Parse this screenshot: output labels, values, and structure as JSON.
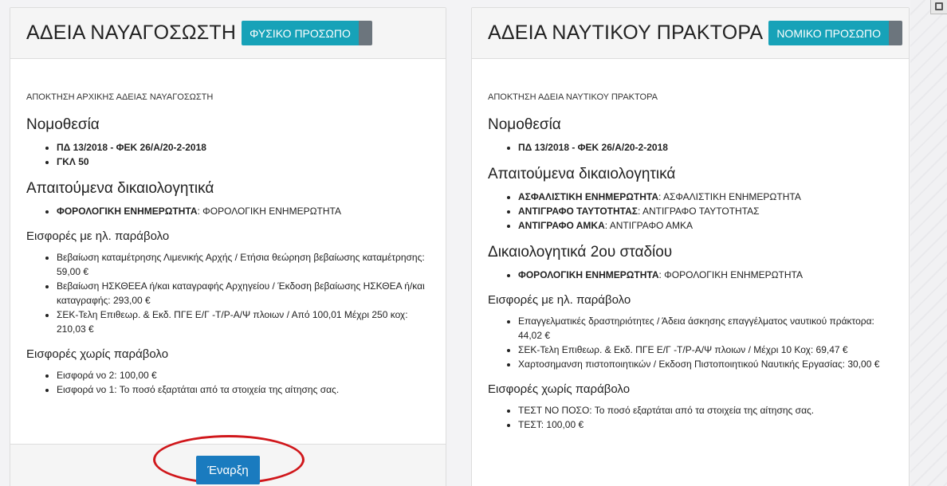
{
  "left_card": {
    "title": "ΑΔΕΙΑ ΝΑΥΑΓΟΣΩΣΤΗ",
    "badge": "ΦΥΣΙΚΟ ΠΡΟΣΩΠΟ",
    "subtitle": "ΑΠΟΚΤΗΣΗ ΑΡΧΙΚΗΣ ΑΔΕΙΑΣ ΝΑΥΑΓΟΣΩΣΤΗ",
    "legislation_heading": "Νομοθεσία",
    "legislation": [
      "ΠΔ 13/2018 - ΦΕΚ 26/Α/20-2-2018",
      "ΓΚΛ 50"
    ],
    "documents_heading": "Απαιτούμενα δικαιολογητικά",
    "documents": [
      {
        "name": "ΦΟΡΟΛΟΓΙΚΗ ΕΝΗΜΕΡΩΤΗΤΑ",
        "desc": ": ΦΟΡΟΛΟΓΙΚΗ ΕΝΗΜΕΡΩΤΗΤΑ"
      }
    ],
    "fees_heading": "Εισφορές με ηλ. παράβολο",
    "fees": [
      "Βεβαίωση καταμέτρησης Λιμενικής Αρχής / Ετήσια θεώρηση βεβαίωσης καταμέτρησης: 59,00 €",
      "Βεβαίωση ΗΣΚΘΕΕΑ ή/και καταγραφής Αρχηγείου / Έκδοση βεβαίωσης ΗΣΚΘΕΑ ή/και καταγραφής: 293,00 €",
      "ΣΕΚ-Τελη Επιθεωρ. & Εκδ. ΠΓΕ Ε/Γ -Τ/Ρ-Α/Ψ πλοιων / Από 100,01 Μέχρι 250 κοχ: 210,03 €"
    ],
    "nofee_heading": "Εισφορές χωρίς παράβολο",
    "nofees": [
      "Εισφορά νο 2: 100,00 €",
      "Εισφορά νο 1: Το ποσό εξαρτάται από τα στοιχεία της αίτησης σας."
    ],
    "start_label": "Έναρξη"
  },
  "right_card": {
    "title": "ΑΔΕΙΑ ΝΑΥΤΙΚΟΥ ΠΡΑΚΤΟΡΑ",
    "badge": "ΝΟΜΙΚΟ ΠΡΟΣΩΠΟ",
    "subtitle": "ΑΠΟΚΤΗΣΗ ΑΔΕΙΑ ΝΑΥΤΙΚΟΥ ΠΡΑΚΤΟΡΑ",
    "legislation_heading": "Νομοθεσία",
    "legislation": [
      "ΠΔ 13/2018 - ΦΕΚ 26/Α/20-2-2018"
    ],
    "documents_heading": "Απαιτούμενα δικαιολογητικά",
    "documents": [
      {
        "name": "ΑΣΦΑΛΙΣΤΙΚΗ ΕΝΗΜΕΡΩΤΗΤΑ",
        "desc": ": ΑΣΦΑΛΙΣΤΙΚΗ ΕΝΗΜΕΡΩΤΗΤΑ"
      },
      {
        "name": "ΑΝΤΙΓΡΑΦΟ ΤΑΥΤΟΤΗΤΑΣ",
        "desc": ": ΑΝΤΙΓΡΑΦΟ ΤΑΥΤΟΤΗΤΑΣ"
      },
      {
        "name": "ΑΝΤΙΓΡΑΦΟ ΑΜΚΑ",
        "desc": ": ΑΝΤΙΓΡΑΦΟ ΑΜΚΑ"
      }
    ],
    "stage2_heading": "Δικαιολογητικά 2ου σταδίου",
    "stage2": [
      {
        "name": "ΦΟΡΟΛΟΓΙΚΗ ΕΝΗΜΕΡΩΤΗΤΑ",
        "desc": ": ΦΟΡΟΛΟΓΙΚΗ ΕΝΗΜΕΡΩΤΗΤΑ"
      }
    ],
    "fees_heading": "Εισφορές με ηλ. παράβολο",
    "fees": [
      "Επαγγελματικές δραστηριότητες / Άδεια άσκησης επαγγέλματος ναυτικού πράκτορα: 44,02 €",
      "ΣΕΚ-Τελη Επιθεωρ. & Εκδ. ΠΓΕ Ε/Γ -Τ/Ρ-Α/Ψ πλοιων / Μέχρι 10 Κοχ: 69,47 €",
      "Χαρτοσημανση πιστοποιητικών / Εκδοση Πιστοποιητικού Ναυτικής Εργασίας: 30,00 €"
    ],
    "nofee_heading": "Εισφορές χωρίς παράβολο",
    "nofees": [
      "ΤΕΣΤ ΝΟ ΠΟΣΟ: Το ποσό εξαρτάται από τα στοιχεία της αίτησης σας.",
      "ΤΕΣΤ: 100,00 €"
    ]
  },
  "colors": {
    "badge": "#17a2b8",
    "toggle": "#6c757d",
    "button": "#1a7bbf",
    "highlight": "#d0171b"
  }
}
